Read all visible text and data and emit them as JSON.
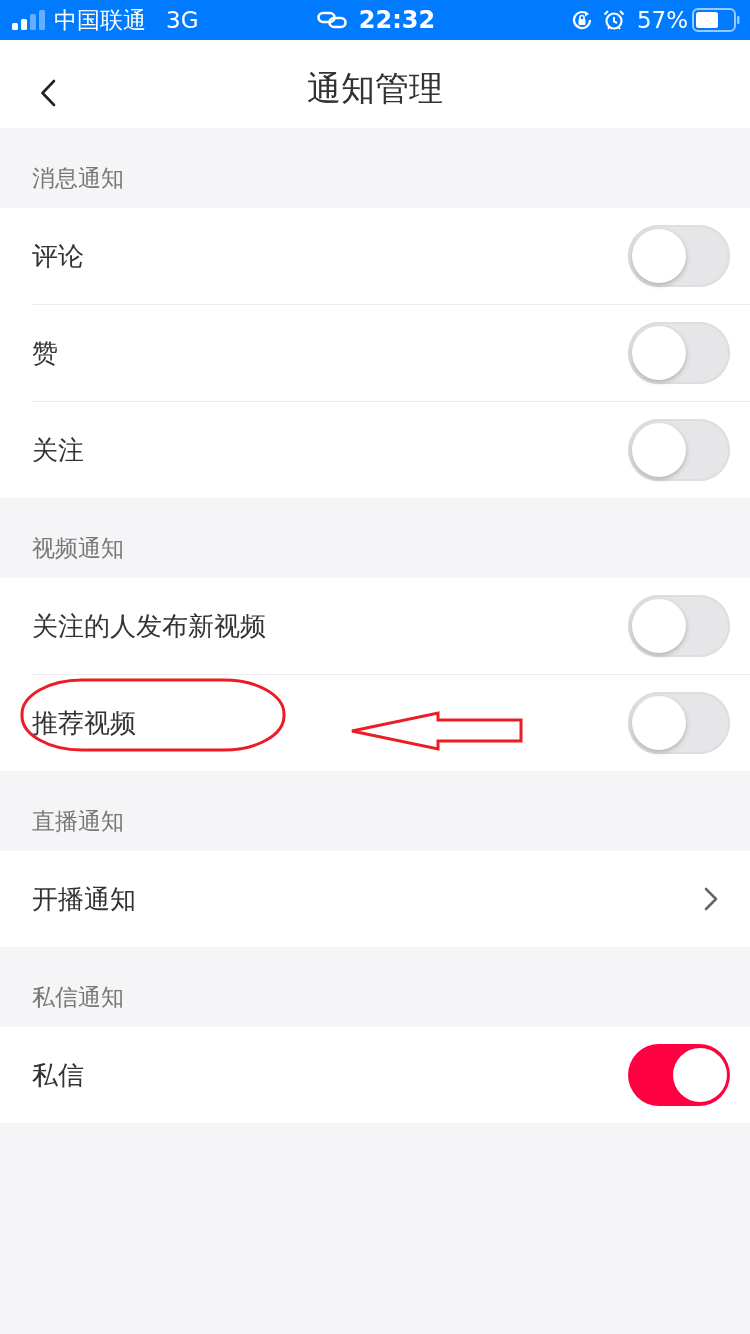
{
  "status_bar": {
    "carrier": "中国联通",
    "network": "3G",
    "time": "22:32",
    "battery": "57%"
  },
  "header": {
    "title": "通知管理"
  },
  "sections": [
    {
      "title": "消息通知",
      "rows": [
        {
          "kind": "toggle",
          "label": "评论",
          "on": false,
          "annotated": false
        },
        {
          "kind": "toggle",
          "label": "赞",
          "on": false,
          "annotated": false
        },
        {
          "kind": "toggle",
          "label": "关注",
          "on": false,
          "annotated": false
        }
      ]
    },
    {
      "title": "视频通知",
      "rows": [
        {
          "kind": "toggle",
          "label": "关注的人发布新视频",
          "on": false,
          "annotated": false
        },
        {
          "kind": "toggle",
          "label": "推荐视频",
          "on": false,
          "annotated": true
        }
      ]
    },
    {
      "title": "直播通知",
      "rows": [
        {
          "kind": "link",
          "label": "开播通知",
          "annotated": false
        }
      ]
    },
    {
      "title": "私信通知",
      "rows": [
        {
          "kind": "toggle",
          "label": "私信",
          "on": true,
          "annotated": false
        }
      ]
    }
  ]
}
